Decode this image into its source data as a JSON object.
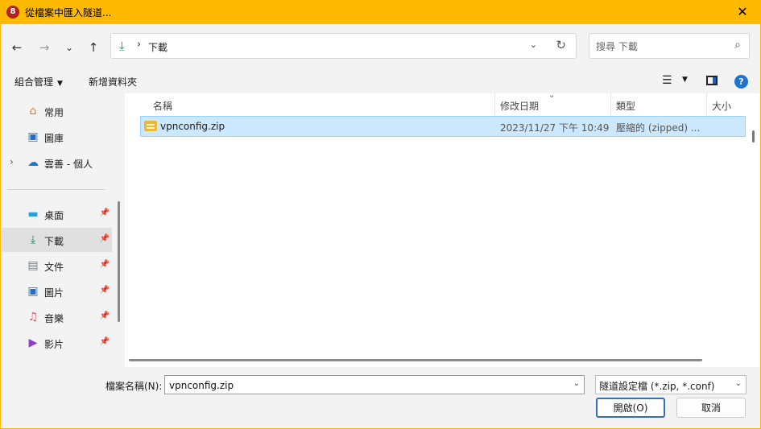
{
  "window": {
    "title": "從檔案中匯入隧道...",
    "app_icon_glyph": "8",
    "close_glyph": "✕"
  },
  "nav": {
    "back_glyph": "←",
    "forward_glyph": "→",
    "recent_glyph": "⌄",
    "up_glyph": "↑"
  },
  "address": {
    "crumb": "下載",
    "separator": "›",
    "dropdown_glyph": "⌄",
    "refresh_glyph": "↻"
  },
  "search": {
    "placeholder": "搜尋 下載"
  },
  "toolbar": {
    "organize_label": "組合管理",
    "new_folder_label": "新增資料夾",
    "help_glyph": "?"
  },
  "sidebar": {
    "items": [
      {
        "label": "常用"
      },
      {
        "label": "圖庫"
      },
      {
        "label": "雲善 - 個人"
      },
      {
        "label": "桌面"
      },
      {
        "label": "下載"
      },
      {
        "label": "文件"
      },
      {
        "label": "圖片"
      },
      {
        "label": "音樂"
      },
      {
        "label": "影片"
      }
    ]
  },
  "columns": {
    "name": "名稱",
    "modified": "修改日期",
    "type": "類型",
    "size": "大小"
  },
  "files": [
    {
      "name": "vpnconfig.zip",
      "modified": "2023/11/27 下午 10:49",
      "type": "壓縮的 (zipped) ..."
    }
  ],
  "bottom": {
    "filename_label": "檔案名稱(N):",
    "filename_value": "vpnconfig.zip",
    "filter_value": "隧道設定檔 (*.zip, *.conf)",
    "open_label": "開啟(O)",
    "cancel_label": "取消"
  },
  "colors": {
    "title_bar": "#ffb900",
    "selection": "#cce8ff",
    "accent": "#2f6fbe"
  }
}
